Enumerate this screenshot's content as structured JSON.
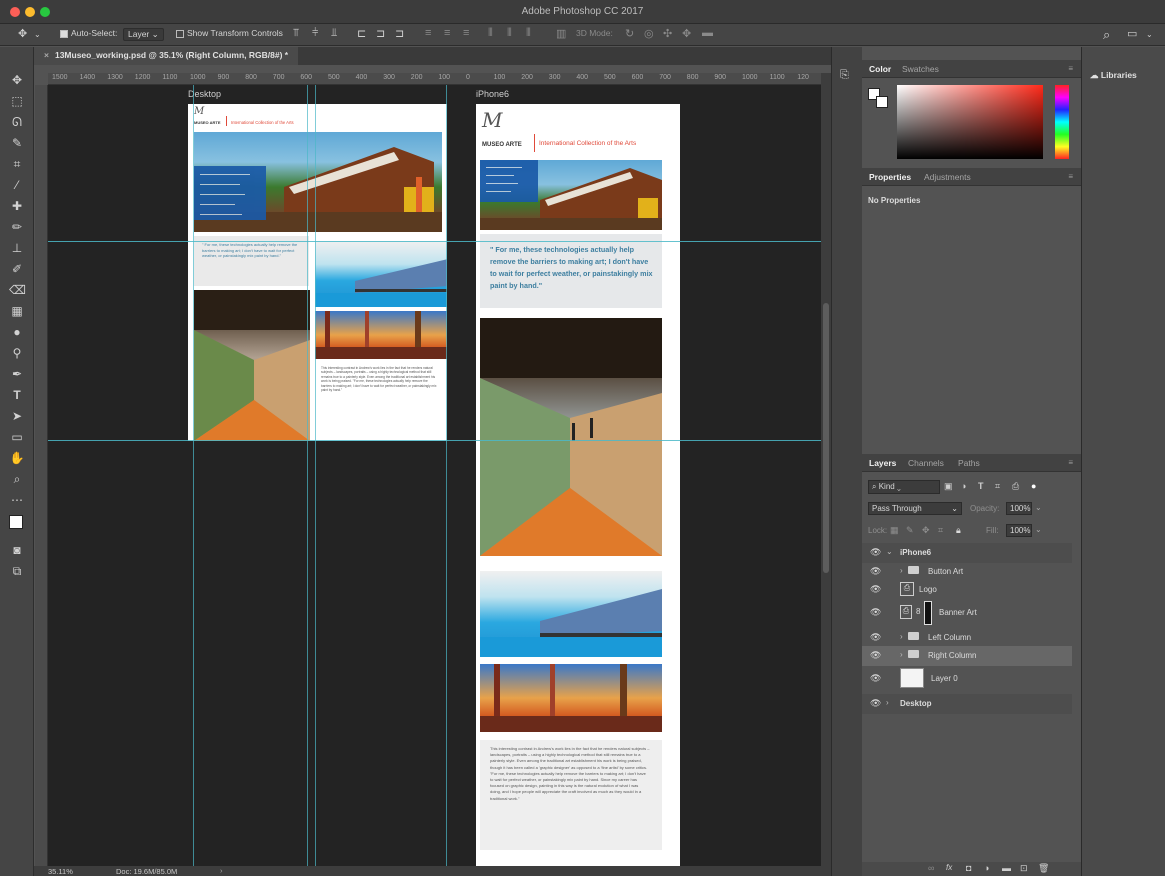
{
  "window": {
    "title": "Adobe Photoshop CC 2017"
  },
  "options_bar": {
    "auto_select_label": "Auto-Select:",
    "auto_select_value": "Layer",
    "show_transform_label": "Show Transform Controls",
    "mode_3d_label": "3D Mode:"
  },
  "document": {
    "tab_title": "13Museo_working.psd @ 35.1% (Right Column, RGB/8#) *",
    "zoom": "35.11%",
    "doc_size": "Doc: 19.6M/85.0M"
  },
  "rulers": {
    "top_ticks": [
      "1500",
      "1400",
      "1300",
      "1200",
      "1100",
      "1000",
      "900",
      "800",
      "700",
      "600",
      "500",
      "400",
      "300",
      "200",
      "100",
      "0",
      "100",
      "200",
      "300",
      "400",
      "500",
      "600",
      "700",
      "800",
      "900",
      "1000",
      "1100",
      "120"
    ]
  },
  "artboards": {
    "desktop": {
      "label": "Desktop",
      "logo": "MUSEO ARTE",
      "tagline": "International Collection of the Arts",
      "quote": "\" For me, these technologies actually help remove the barriers to making art; I don't have to wait for perfect weather, or painstakingly mix paint by hand.\"",
      "body": "This interesting contrast in Andrew's work lies in the fact that he renders natural subjects – landscapes, portraits – using a highly technological method that still remains true to a painterly style. Even among the traditional art establishment his work is being praised. \"For me, these technologies actually help remove the barriers to making art; I don't have to wait for perfect weather, or painstakingly mix paint by hand.\""
    },
    "iphone": {
      "label": "iPhone6",
      "logo": "MUSEO ARTE",
      "tagline": "International Collection of the Arts",
      "quote": "\" For me, these technologies actually help remove the barriers to making art; I don't have to wait for perfect weather, or painstakingly mix paint by hand.\"",
      "body": "This interesting contrast in Andrew's work lies in the fact that he renders natural subjects – landscapes, portraits – using a highly technological method that still remains true to a painterly style. Even among the traditional art establishment his work is being praised, though it has been called a 'graphic designer' as opposed to a 'fine artist' by some critics. \"For me, these technologies actually help remove the barriers to making art; I don't have to wait for perfect weather, or painstakingly mix paint by hand. Since my career has focused on graphic design, painting in this way is the natural evolution of what I was doing, and I hope people will appreciate the craft involved as much as they would in a traditional work.\""
    }
  },
  "color_panel": {
    "tabs": [
      "Color",
      "Swatches"
    ]
  },
  "properties_panel": {
    "tabs": [
      "Properties",
      "Adjustments"
    ],
    "empty_text": "No Properties"
  },
  "layers_panel": {
    "tabs": [
      "Layers",
      "Channels",
      "Paths"
    ],
    "kind_label": "Kind",
    "blend_mode": "Pass Through",
    "opacity_label": "Opacity:",
    "opacity_value": "100%",
    "lock_label": "Lock:",
    "fill_label": "Fill:",
    "fill_value": "100%",
    "layers": [
      {
        "name": "iPhone6"
      },
      {
        "name": "Button Art"
      },
      {
        "name": "Logo"
      },
      {
        "name": "Banner Art"
      },
      {
        "name": "Left Column"
      },
      {
        "name": "Right Column"
      },
      {
        "name": "Layer 0"
      },
      {
        "name": "Desktop"
      }
    ]
  },
  "libraries": {
    "label": "Libraries"
  }
}
